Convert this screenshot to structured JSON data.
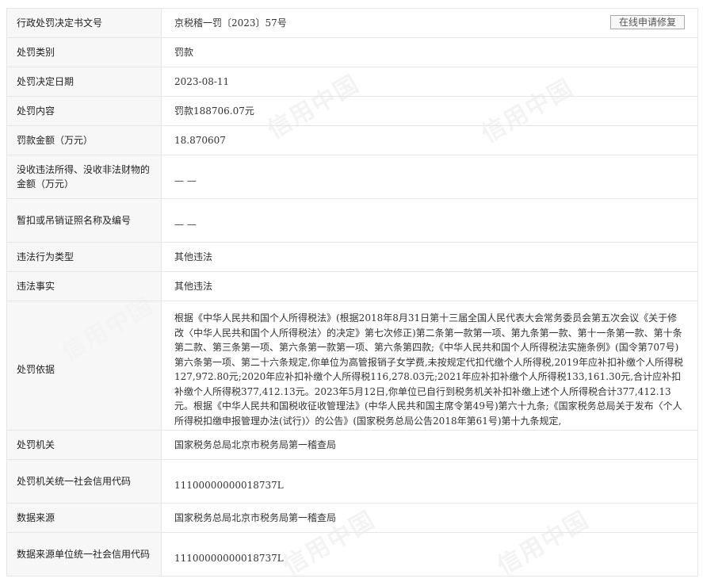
{
  "repair_button": "在线申请修复",
  "rows": [
    {
      "label": "行政处罚决定书文号",
      "value": "京税稽一罚〔2023〕57号"
    },
    {
      "label": "处罚类别",
      "value": "罚款"
    },
    {
      "label": "处罚决定日期",
      "value": "2023-08-11"
    },
    {
      "label": "处罚内容",
      "value": "罚款188706.07元"
    },
    {
      "label": "罚款金额（万元）",
      "value": "18.870607"
    },
    {
      "label": "没收违法所得、没收非法财物的金额（万元）",
      "value": "— —"
    },
    {
      "label": "暂扣或吊销证照名称及编号",
      "value": "— —"
    },
    {
      "label": "违法行为类型",
      "value": "其他违法"
    },
    {
      "label": "违法事实",
      "value": "其他违法"
    },
    {
      "label": "处罚依据",
      "value": "根据《中华人民共和国个人所得税法》(根据2018年8月31日第十三届全国人民代表大会常务委员会第五次会议《关于修改〈中华人民共和国个人所得税法〉的决定》第七次修正)第二条第一款第一项、第九条第一款、第十一条第一款、第十条第二款、第三条第一项、第六条第一款第一项、第六条第四款;《中华人民共和国个人所得税法实施条例》(国令第707号)第六条第一项、第二十六条规定,你单位为高管报销子女学费,未按规定代扣代缴个人所得税,2019年应补扣补缴个人所得税127,972.80元;2020年应补扣补缴个人所得税116,278.03元;2021年应补扣补缴个人所得税133,161.30元,合计应补扣补缴个人所得税377,412.13元。2023年5月12日,你单位已自行到税务机关补扣补缴上述个人所得税合计377,412.13元。根据《中华人民共和国税收征收管理法》(中华人民共和国主席令第49号)第六十九条;《国家税务总局关于发布〈个人所得税扣缴申报管理办法(试行)〉的公告》(国家税务总局公告2018年第61号)第十九条规定,"
    },
    {
      "label": "处罚机关",
      "value": "国家税务总局北京市税务局第一稽查局"
    },
    {
      "label": "处罚机关统一社会信用代码",
      "value": "11100000000018737L"
    },
    {
      "label": "数据来源",
      "value": "国家税务总局北京市税务局第一稽查局"
    },
    {
      "label": "数据来源单位统一社会信用代码",
      "value": "11100000000018737L"
    }
  ],
  "watermark_text": "信用中国"
}
